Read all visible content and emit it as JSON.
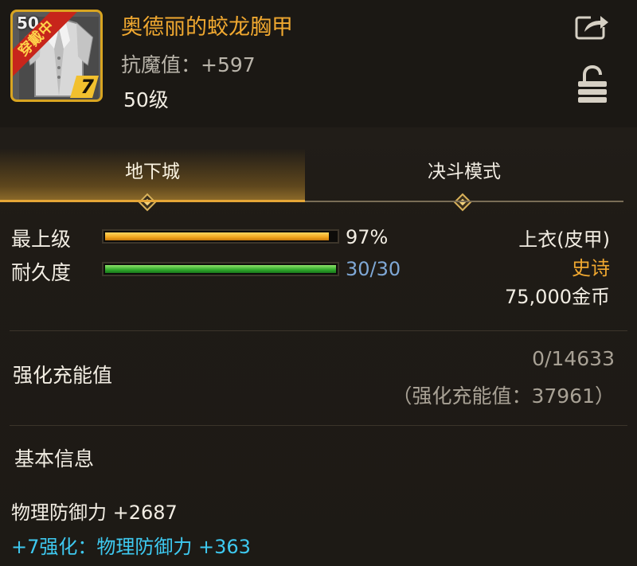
{
  "item": {
    "level_tag": "50",
    "equipped_label": "穿戴中",
    "enhance_level": "7",
    "name": "奥德丽的蛟龙胸甲",
    "stat_line": "抗魔值：+597",
    "level_line": "50级"
  },
  "tabs": [
    {
      "label": "地下城",
      "active": true
    },
    {
      "label": "决斗模式",
      "active": false
    }
  ],
  "bars": {
    "max_label": "最上级",
    "max_value": "97%",
    "max_fraction": 0.97,
    "durability_label": "耐久度",
    "durability_value": "30/30",
    "durability_fraction": 1.0
  },
  "item_type": {
    "slot": "上衣(皮甲)",
    "rarity": "史诗",
    "price": "75,000金币"
  },
  "charge": {
    "title": "强化充能值",
    "progress": "0/14633",
    "total": "（强化充能值：37961）"
  },
  "basic_info": {
    "title": "基本信息",
    "physical_defense": "物理防御力 +2687",
    "enhance_bonus": "+7强化：物理防御力 +363"
  },
  "colors": {
    "name": "#f0a830",
    "rarity": "#f0a830",
    "enhance_bonus": "#3ec9f0",
    "durability_text": "#7fa8d6"
  },
  "icons": {
    "share": "share-icon",
    "lock": "lock-icon",
    "item": "coat-icon"
  }
}
